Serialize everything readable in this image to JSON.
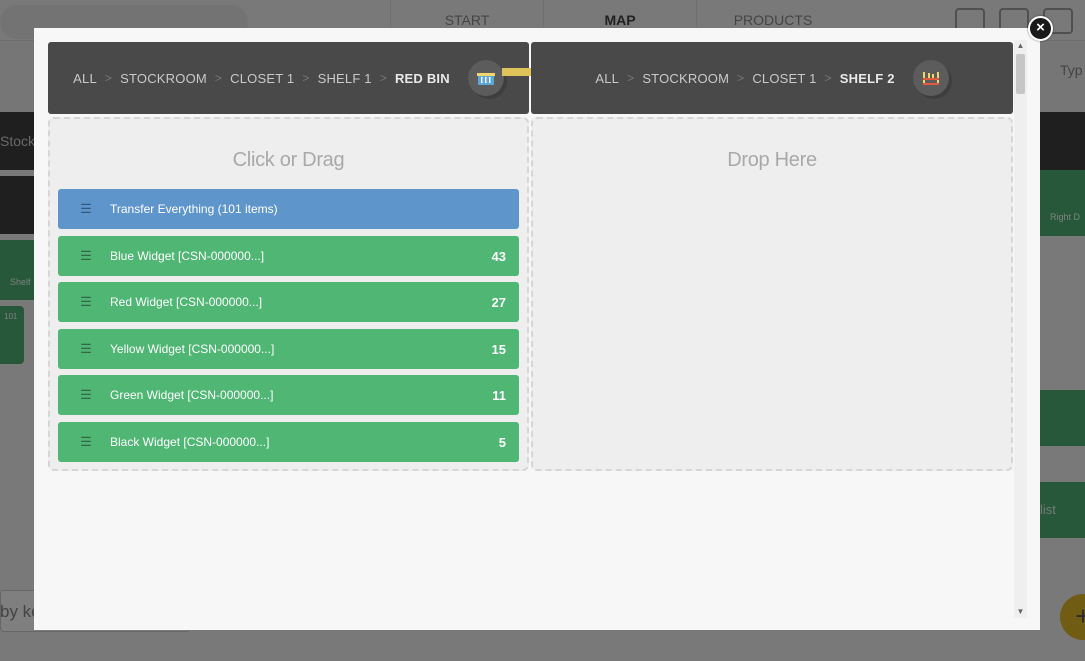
{
  "background": {
    "nav_tabs": [
      "START",
      "MAP",
      "PRODUCTS"
    ],
    "active_tab": "MAP",
    "type_label": "Typ",
    "stockroom_label": "Stock",
    "shelf_label": "Shelf",
    "count_label": "101",
    "right_label": "Right D",
    "list_label": "list",
    "search_placeholder": "by ke",
    "fab_label": "+"
  },
  "modal": {
    "close_label": "×",
    "source": {
      "crumbs": [
        "ALL",
        "STOCKROOM",
        "CLOSET 1",
        "SHELF 1"
      ],
      "current": "RED BIN",
      "icon": "bin-icon"
    },
    "destination": {
      "crumbs": [
        "ALL",
        "STOCKROOM",
        "CLOSET 1"
      ],
      "current": "SHELF 2",
      "icon": "shelf-icon"
    },
    "separator": ">",
    "left_panel_title": "Click or Drag",
    "right_panel_title": "Drop Here",
    "transfer_all": "Transfer Everything (101 items)",
    "items": [
      {
        "name": "Blue Widget [CSN-000000...]",
        "qty": "43"
      },
      {
        "name": "Red Widget [CSN-000000...]",
        "qty": "27"
      },
      {
        "name": "Yellow Widget [CSN-000000...]",
        "qty": "15"
      },
      {
        "name": "Green Widget [CSN-000000...]",
        "qty": "11"
      },
      {
        "name": "Black Widget [CSN-000000...]",
        "qty": "5"
      }
    ],
    "colors": {
      "transfer_all": "#5e95cb",
      "item": "#4fb673",
      "arrow": "#e0c25a",
      "breadcrumb_bar": "#494949"
    }
  }
}
